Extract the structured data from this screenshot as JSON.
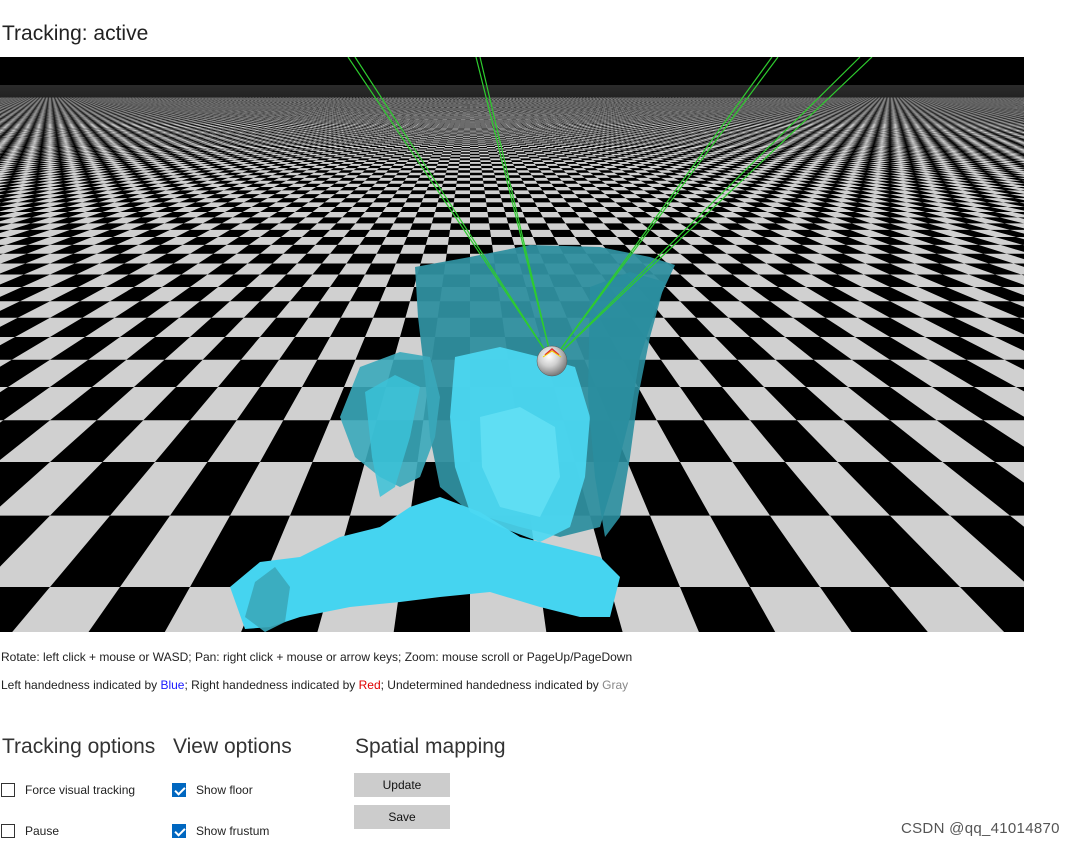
{
  "status": {
    "text": "Tracking: active"
  },
  "help": {
    "controls": "Rotate: left click + mouse or WASD; Pan: right click + mouse or arrow keys; Zoom: mouse scroll or PageUp/PageDown",
    "hand_prefix": "Left handedness indicated by ",
    "hand_blue": "Blue",
    "hand_mid": "; Right handedness indicated by ",
    "hand_red": "Red",
    "hand_mid2": "; Undetermined handedness indicated by ",
    "hand_gray": "Gray"
  },
  "sections": {
    "tracking": {
      "title": "Tracking options",
      "options": [
        {
          "label": "Force visual tracking",
          "checked": false
        },
        {
          "label": "Pause",
          "checked": false
        }
      ]
    },
    "view": {
      "title": "View options",
      "options": [
        {
          "label": "Show floor",
          "checked": true
        },
        {
          "label": "Show frustum",
          "checked": true
        }
      ]
    },
    "mapping": {
      "title": "Spatial mapping",
      "update_label": "Update",
      "save_label": "Save"
    }
  },
  "watermark": "CSDN @qq_41014870",
  "colors": {
    "mesh": "#45d4f0",
    "mesh_dark": "#2a8e9e",
    "rays": "#2ecc2e",
    "floor_light": "#d0d0d0",
    "floor_dark": "#000000"
  }
}
